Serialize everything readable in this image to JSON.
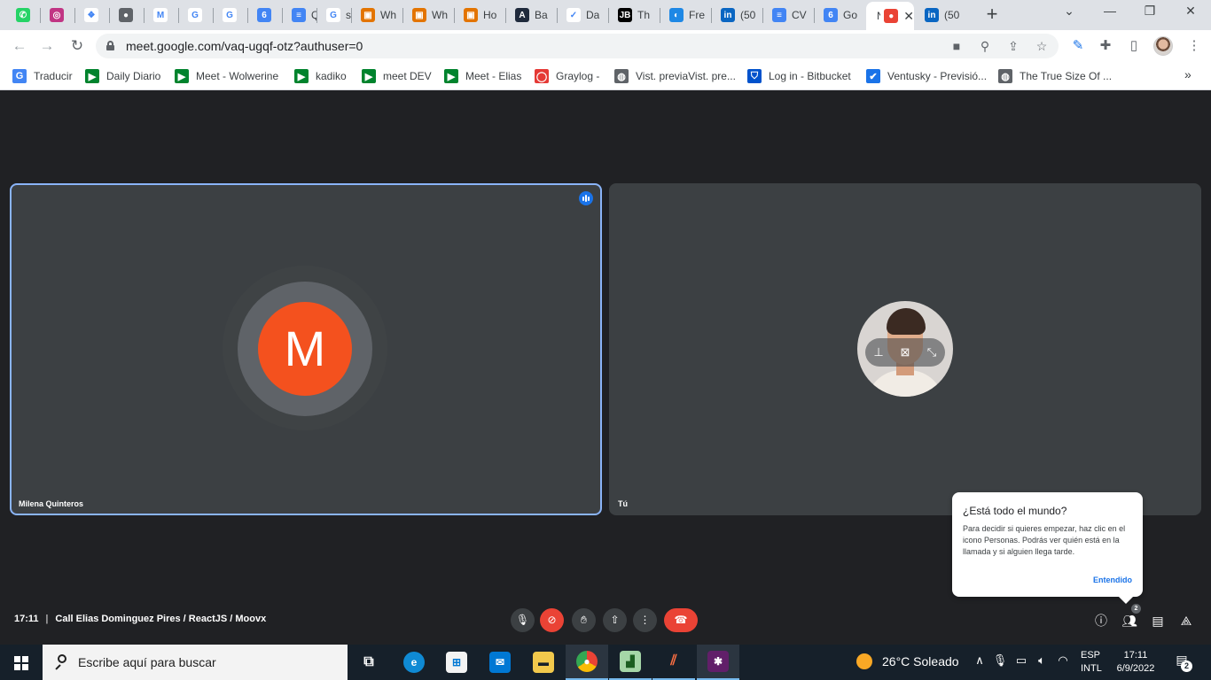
{
  "browser": {
    "tabs": [
      {
        "title": "",
        "icon": "whatsapp-icon",
        "color": "#25d366",
        "glyph": "✆"
      },
      {
        "title": "",
        "icon": "instagram-icon",
        "color": "#c13584",
        "glyph": "◎"
      },
      {
        "title": "",
        "icon": "app-icon",
        "color": "#ffffff",
        "glyph": "❖"
      },
      {
        "title": "",
        "icon": "record-icon",
        "color": "#5f6368",
        "glyph": "●"
      },
      {
        "title": "",
        "icon": "gmail-icon",
        "color": "#ffffff",
        "glyph": "M"
      },
      {
        "title": "",
        "icon": "google-icon",
        "color": "#ffffff",
        "glyph": "G"
      },
      {
        "title": "",
        "icon": "google-icon",
        "color": "#ffffff",
        "glyph": "G"
      },
      {
        "title": "",
        "icon": "calendar-icon",
        "color": "#4285f4",
        "glyph": "6"
      },
      {
        "title": "Qu",
        "icon": "docs-icon",
        "color": "#4285f4",
        "glyph": "≡"
      },
      {
        "title": "ste",
        "icon": "google-icon",
        "color": "#ffffff",
        "glyph": "G"
      },
      {
        "title": "Wh",
        "icon": "orange-app-icon",
        "color": "#e37400",
        "glyph": "▣"
      },
      {
        "title": "Wh",
        "icon": "orange-app-icon",
        "color": "#e37400",
        "glyph": "▣"
      },
      {
        "title": "Ho",
        "icon": "orange-app-icon",
        "color": "#e37400",
        "glyph": "▣"
      },
      {
        "title": "Ba",
        "icon": "dark-app-icon",
        "color": "#1f2a3c",
        "glyph": "A"
      },
      {
        "title": "Da",
        "icon": "check-icon",
        "color": "#ffffff",
        "glyph": "✓"
      },
      {
        "title": "Th",
        "icon": "jb-icon",
        "color": "#000000",
        "glyph": "JB"
      },
      {
        "title": "Fre",
        "icon": "globe-icon",
        "color": "#1e88e5",
        "glyph": "◐"
      },
      {
        "title": "(50",
        "icon": "linkedin-icon",
        "color": "#0a66c2",
        "glyph": "in"
      },
      {
        "title": "CV",
        "icon": "docs-icon",
        "color": "#4285f4",
        "glyph": "≡"
      },
      {
        "title": "Go",
        "icon": "calendar-icon",
        "color": "#4285f4",
        "glyph": "6"
      },
      {
        "title": "N",
        "icon": "recording-icon",
        "color": "#ea4335",
        "glyph": "●",
        "active": true
      },
      {
        "title": "(50",
        "icon": "linkedin-icon",
        "color": "#0a66c2",
        "glyph": "in"
      }
    ],
    "new_tab": "+",
    "url": "meet.google.com/vaq-ugqf-otz?authuser=0"
  },
  "bookmarks": [
    {
      "label": "Traducir",
      "icon": "translate-icon",
      "color": "#4285f4",
      "glyph": "G"
    },
    {
      "label": "Daily Diario",
      "icon": "meet-icon",
      "color": "#00832d",
      "glyph": "▶"
    },
    {
      "label": "Meet - Wolwerine",
      "icon": "meet-icon",
      "color": "#00832d",
      "glyph": "▶"
    },
    {
      "label": "kadiko",
      "icon": "meet-icon",
      "color": "#00832d",
      "glyph": "▶"
    },
    {
      "label": "meet DEV",
      "icon": "meet-icon",
      "color": "#00832d",
      "glyph": "▶"
    },
    {
      "label": "Meet - Elias",
      "icon": "meet-icon",
      "color": "#00832d",
      "glyph": "▶"
    },
    {
      "label": "Graylog -",
      "icon": "graylog-icon",
      "color": "#e53935",
      "glyph": "◯"
    },
    {
      "label": "Vist. previaVist. pre...",
      "icon": "globe-icon",
      "color": "#5f6368",
      "glyph": "◍"
    },
    {
      "label": "Log in - Bitbucket",
      "icon": "bitbucket-icon",
      "color": "#0052cc",
      "glyph": "⛉"
    },
    {
      "label": "Ventusky - Previsió...",
      "icon": "ventusky-icon",
      "color": "#1a73e8",
      "glyph": "✔"
    },
    {
      "label": "The True Size Of ...",
      "icon": "globe-icon",
      "color": "#5f6368",
      "glyph": "◍"
    }
  ],
  "meet": {
    "participant1": {
      "name": "Milena Quinteros",
      "initial": "M",
      "color": "#f4511e"
    },
    "participant2": {
      "name": "Tú"
    },
    "popup": {
      "title": "¿Está todo el mundo?",
      "body": "Para decidir si quieres empezar, haz clic en el icono Personas. Podrás ver quién está en la llamada y si alguien llega tarde.",
      "button": "Entendido"
    },
    "time": "17:11",
    "meeting_name": "Call Elias Dominguez Pires / ReactJS / Moovx",
    "people_count": "2"
  },
  "taskbar": {
    "search_placeholder": "Escribe aquí para buscar",
    "weather": "26°C  Soleado",
    "lang_line1": "ESP",
    "lang_line2": "INTL",
    "time": "17:11",
    "date": "6/9/2022",
    "notifications": "2"
  }
}
